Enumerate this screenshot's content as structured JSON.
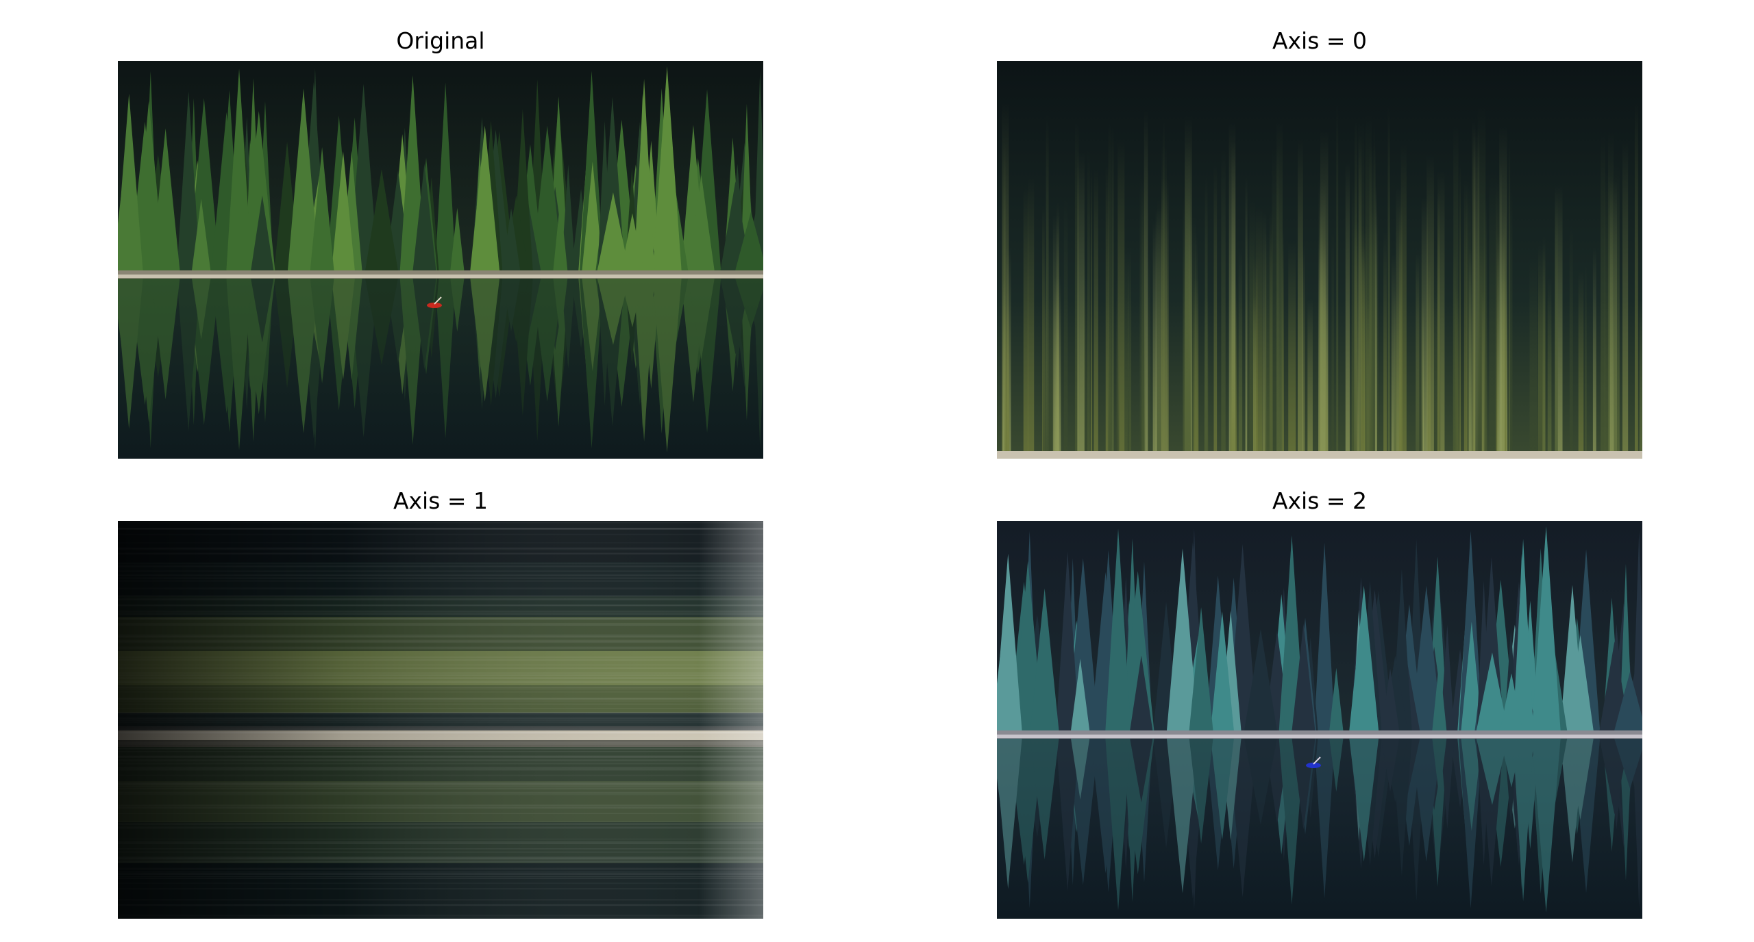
{
  "figure": {
    "panels": [
      {
        "title": "Original",
        "image": "lake-forest-photo-original"
      },
      {
        "title": "Axis = 0",
        "image": "lake-forest-sorted-along-axis-0"
      },
      {
        "title": "Axis = 1",
        "image": "lake-forest-sorted-along-axis-1"
      },
      {
        "title": "Axis = 2",
        "image": "lake-forest-sorted-along-axis-2"
      }
    ]
  },
  "colors": {
    "background": "#ffffff",
    "sky": "#0f1a1a",
    "forest_green": "#2f5a2a",
    "bright_green": "#5e8d3c",
    "shore": "#c9c2b0",
    "water": "#14242a",
    "olive": "#7f8a4a",
    "teal": "#3f8a8a",
    "boat_red": "#c92a1f",
    "boat_blue": "#2233cc"
  }
}
